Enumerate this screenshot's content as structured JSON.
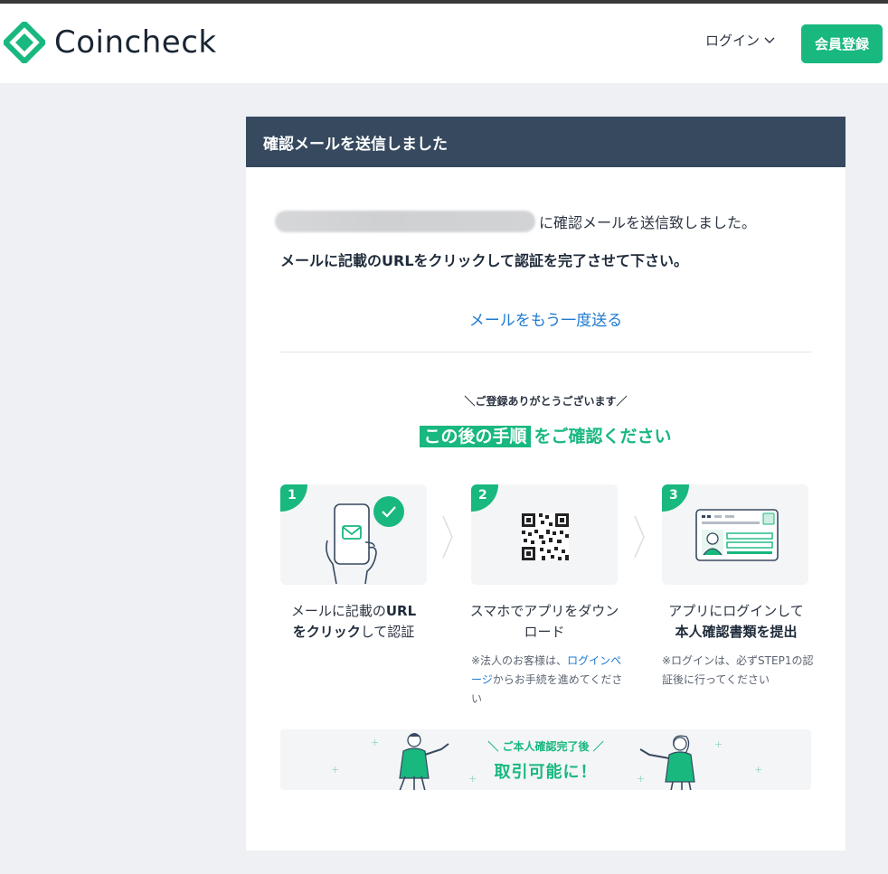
{
  "header": {
    "brand": "Coincheck",
    "login_label": "ログイン",
    "signup_label": "会員登録"
  },
  "card": {
    "title": "確認メールを送信しました",
    "sent_suffix": "に確認メールを送信致しました。",
    "instruction": "メールに記載のURLをクリックして認証を完了させて下さい。",
    "resend_link": "メールをもう一度送る",
    "thanks": "＼ご登録ありがとうございます／",
    "next_highlight": "この後の手順",
    "next_rest": "をご確認ください"
  },
  "steps": [
    {
      "num": "1",
      "text_a": "メールに記載の",
      "text_b": "URL",
      "text_c": "をクリック",
      "text_d": "して認証",
      "icon": "phone-mail-icon"
    },
    {
      "num": "2",
      "text": "スマホでアプリをダウンロード",
      "note_a": "※法人のお客様は、",
      "note_link": "ログインページ",
      "note_b": "からお手続を進めてください",
      "icon": "qr-code-icon"
    },
    {
      "num": "3",
      "text_a": "アプリにログインして",
      "text_b": "本人確認書類を提出",
      "note": "※ログインは、必ずSTEP1の認証後に行ってください",
      "icon": "id-card-icon"
    }
  ],
  "banner": {
    "sub": "＼ ご本人確認完了後 ／",
    "main": "取引可能に！"
  },
  "colors": {
    "brand_green": "#18b87f",
    "header_navy": "#36495f",
    "link_blue": "#1f7ad0",
    "page_bg": "#eef0f4"
  }
}
